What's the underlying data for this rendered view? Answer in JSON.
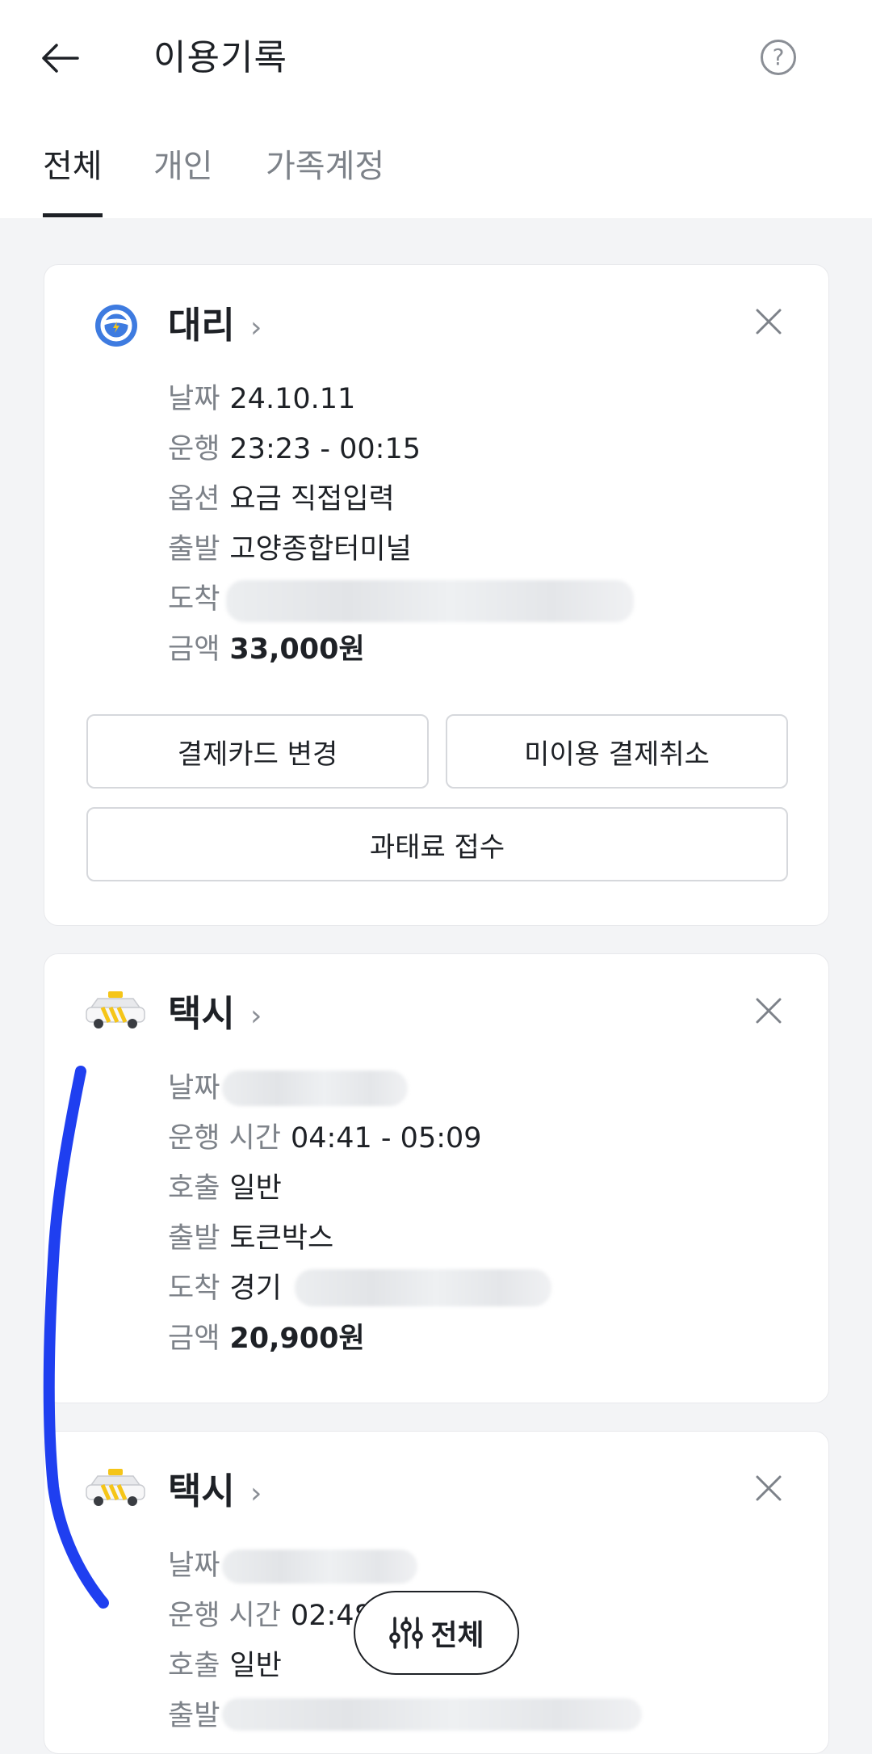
{
  "header": {
    "title": "이용기록",
    "help_glyph": "?"
  },
  "tabs": [
    {
      "label": "전체",
      "active": true
    },
    {
      "label": "개인",
      "active": false
    },
    {
      "label": "가족계정",
      "active": false
    }
  ],
  "cards": [
    {
      "service": "대리",
      "icon": "steering-wheel-icon",
      "rows": [
        {
          "label": "날짜",
          "value": "24.10.11"
        },
        {
          "label": "운행",
          "value": "23:23 - 00:15"
        },
        {
          "label": "옵션",
          "value": "요금 직접입력"
        },
        {
          "label": "출발",
          "value": "고양종합터미널"
        },
        {
          "label": "도착",
          "value": ""
        },
        {
          "label": "금액",
          "value": "33,000원"
        }
      ],
      "buttons": {
        "change_card": "결제카드 변경",
        "cancel_unused": "미이용 결제취소",
        "fine_submit": "과태료 접수"
      }
    },
    {
      "service": "택시",
      "icon": "taxi-icon",
      "rows": [
        {
          "label": "날짜",
          "value": ""
        },
        {
          "label": "운행 시간",
          "value": "04:41 - 05:09"
        },
        {
          "label": "호출",
          "value": "일반"
        },
        {
          "label": "출발",
          "value": "토큰박스"
        },
        {
          "label": "도착",
          "value": "경기"
        },
        {
          "label": "금액",
          "value": "20,900원"
        }
      ]
    },
    {
      "service": "택시",
      "icon": "taxi-icon",
      "rows": [
        {
          "label": "날짜",
          "value": ""
        },
        {
          "label": "운행 시간",
          "value": "02:48"
        },
        {
          "label": "호출",
          "value": "일반"
        },
        {
          "label": "출발",
          "value": ""
        }
      ]
    }
  ],
  "filter_button": {
    "label": "전체",
    "icon": "filter-sliders-icon"
  },
  "colors": {
    "text_primary": "#1e2126",
    "text_secondary": "#7d8289",
    "background": "#f3f4f6",
    "card": "#ffffff",
    "annotation_stroke": "#1f3ff0",
    "taxi_yellow": "#f5c518",
    "driver_blue": "#3e7be0"
  }
}
